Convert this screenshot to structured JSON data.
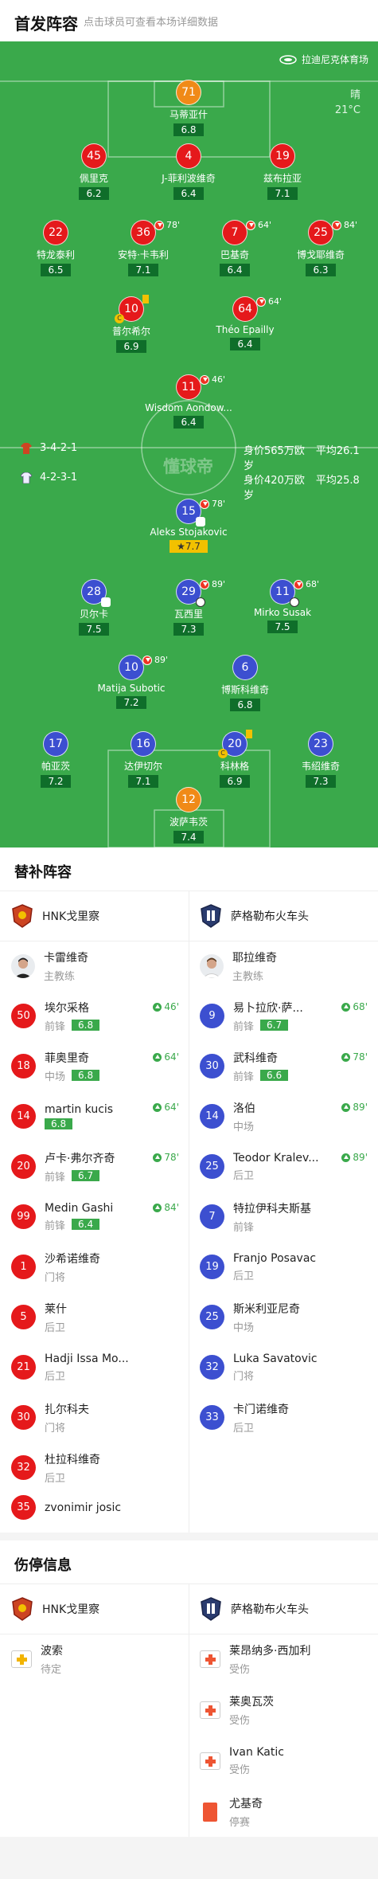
{
  "header": {
    "title": "首发阵容",
    "subtitle": "点击球员可查看本场详细数据"
  },
  "pitch": {
    "venue": "拉迪尼克体育场",
    "weather": "晴",
    "temperature": "21°C",
    "watermark": "懂球帝",
    "home_formation": "3-4-2-1",
    "away_formation": "4-2-3-1",
    "home_value": "身价565万欧",
    "home_age": "平均26.1岁",
    "away_value": "身价420万欧",
    "away_age": "平均25.8岁"
  },
  "home_players": [
    {
      "num": "71",
      "name": "马蒂亚什",
      "rating": "6.8"
    },
    {
      "num": "45",
      "name": "佩里克",
      "rating": "6.2"
    },
    {
      "num": "4",
      "name": "J-菲利波维奇",
      "rating": "6.4"
    },
    {
      "num": "19",
      "name": "兹布拉亚",
      "rating": "7.1"
    },
    {
      "num": "22",
      "name": "特龙泰利",
      "rating": "6.5"
    },
    {
      "num": "36",
      "name": "安特·卡韦利",
      "rating": "7.1",
      "sub": "78'"
    },
    {
      "num": "7",
      "name": "巴基奇",
      "rating": "6.4",
      "sub": "64'"
    },
    {
      "num": "25",
      "name": "博戈耶维奇",
      "rating": "6.3",
      "sub": "84'"
    },
    {
      "num": "10",
      "name": "普尔希尔",
      "rating": "6.9",
      "badge": "C"
    },
    {
      "num": "64",
      "name": "Théo Epailly",
      "rating": "6.4",
      "sub": "64'"
    },
    {
      "num": "11",
      "name": "Wisdom Aondow...",
      "rating": "6.4",
      "sub": "46'"
    }
  ],
  "away_players": [
    {
      "num": "15",
      "name": "Aleks Stojakovic",
      "rating": "7.7",
      "sub": "78'"
    },
    {
      "num": "28",
      "name": "贝尔卡",
      "rating": "7.5"
    },
    {
      "num": "29",
      "name": "瓦西里",
      "rating": "7.3",
      "sub": "89'"
    },
    {
      "num": "11",
      "name": "Mirko Susak",
      "rating": "7.5",
      "sub": "68'"
    },
    {
      "num": "10",
      "name": "Matija Subotic",
      "rating": "7.2",
      "sub": "89'"
    },
    {
      "num": "6",
      "name": "博斯科维奇",
      "rating": "6.8"
    },
    {
      "num": "17",
      "name": "帕亚茨",
      "rating": "7.2"
    },
    {
      "num": "16",
      "name": "达伊切尔",
      "rating": "7.1"
    },
    {
      "num": "20",
      "name": "科林格",
      "rating": "6.9",
      "badge": "C"
    },
    {
      "num": "23",
      "name": "韦绍维奇",
      "rating": "7.3"
    },
    {
      "num": "12",
      "name": "波萨韦茨",
      "rating": "7.4"
    }
  ],
  "subs": {
    "title": "替补阵容",
    "home_team": "HNK戈里察",
    "away_team": "萨格勒布火车头",
    "home_coach": {
      "name": "卡雷维奇",
      "role": "主教练"
    },
    "away_coach": {
      "name": "耶拉维奇",
      "role": "主教练"
    },
    "home": [
      {
        "num": "50",
        "name": "埃尔采格",
        "pos": "前锋",
        "rating": "6.8",
        "time": "46'"
      },
      {
        "num": "18",
        "name": "菲奥里奇",
        "pos": "中场",
        "rating": "6.8",
        "time": "64'"
      },
      {
        "num": "14",
        "name": "martin kucis",
        "pos": "",
        "rating": "6.8",
        "time": "64'"
      },
      {
        "num": "20",
        "name": "卢卡·弗尔齐奇",
        "pos": "前锋",
        "rating": "6.7",
        "time": "78'"
      },
      {
        "num": "99",
        "name": "Medin Gashi",
        "pos": "前锋",
        "rating": "6.4",
        "time": "84'"
      },
      {
        "num": "1",
        "name": "沙希诺维奇",
        "pos": "门将"
      },
      {
        "num": "5",
        "name": "莱什",
        "pos": "后卫"
      },
      {
        "num": "21",
        "name": "Hadji Issa Mo...",
        "pos": "后卫"
      },
      {
        "num": "30",
        "name": "扎尔科夫",
        "pos": "门将"
      },
      {
        "num": "32",
        "name": "杜拉科维奇",
        "pos": "后卫"
      },
      {
        "num": "35",
        "name": "zvonimir josic",
        "pos": ""
      }
    ],
    "away": [
      {
        "num": "9",
        "name": "易卜拉欣·萨...",
        "pos": "前锋",
        "rating": "6.7",
        "time": "68'"
      },
      {
        "num": "30",
        "name": "武科维奇",
        "pos": "前锋",
        "rating": "6.6",
        "time": "78'"
      },
      {
        "num": "14",
        "name": "洛伯",
        "pos": "中场",
        "time": "89'"
      },
      {
        "num": "25",
        "name": "Teodor Kralev...",
        "pos": "后卫",
        "time": "89'"
      },
      {
        "num": "7",
        "name": "特拉伊科夫斯基",
        "pos": "前锋"
      },
      {
        "num": "19",
        "name": "Franjo Posavac",
        "pos": "后卫"
      },
      {
        "num": "25",
        "name": "斯米利亚尼奇",
        "pos": "中场"
      },
      {
        "num": "32",
        "name": "Luka Savatovic",
        "pos": "门将"
      },
      {
        "num": "33",
        "name": "卡门诺维奇",
        "pos": "后卫"
      }
    ]
  },
  "injuries": {
    "title": "伤停信息",
    "home_team": "HNK戈里察",
    "away_team": "萨格勒布火车头",
    "home": [
      {
        "name": "波索",
        "status": "待定"
      }
    ],
    "away": [
      {
        "name": "莱昂纳多·西加利",
        "status": "受伤"
      },
      {
        "name": "莱奥瓦茨",
        "status": "受伤"
      },
      {
        "name": "Ivan Katic",
        "status": "受伤"
      },
      {
        "name": "尤基奇",
        "status": "停赛"
      }
    ]
  }
}
